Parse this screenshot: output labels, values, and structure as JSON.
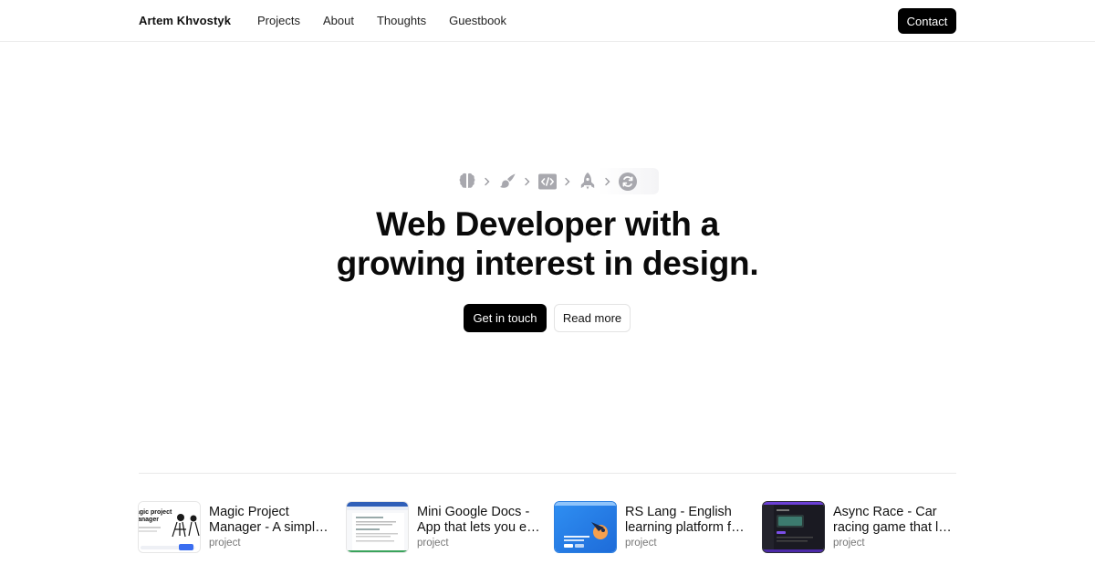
{
  "header": {
    "brand": "Artem Khvostyk",
    "nav": [
      "Projects",
      "About",
      "Thoughts",
      "Guestbook"
    ],
    "contact_label": "Contact"
  },
  "chain": {
    "icons": [
      "brain-icon",
      "paint-brush-icon",
      "code-icon",
      "rocket-icon",
      "refresh-icon"
    ],
    "separator": "chevron-right-icon"
  },
  "hero": {
    "title_line1": "Web Developer with a",
    "title_line2": "growing interest in design.",
    "primary_label": "Get in touch",
    "secondary_label": "Read more"
  },
  "projects": [
    {
      "title": "Magic Project Manager - A simple project manager",
      "type": "project",
      "thumb_text": "Magic project manager"
    },
    {
      "title": "Mini Google Docs - App that lets you edit documents",
      "type": "project"
    },
    {
      "title": "RS Lang - English learning platform for everyone",
      "type": "project"
    },
    {
      "title": "Async Race - Car racing game that lets you race",
      "type": "project"
    }
  ],
  "colors": {
    "primary": "#000000",
    "text": "#111111",
    "muted": "#777777",
    "icon_gray": "#a8a8ae"
  }
}
